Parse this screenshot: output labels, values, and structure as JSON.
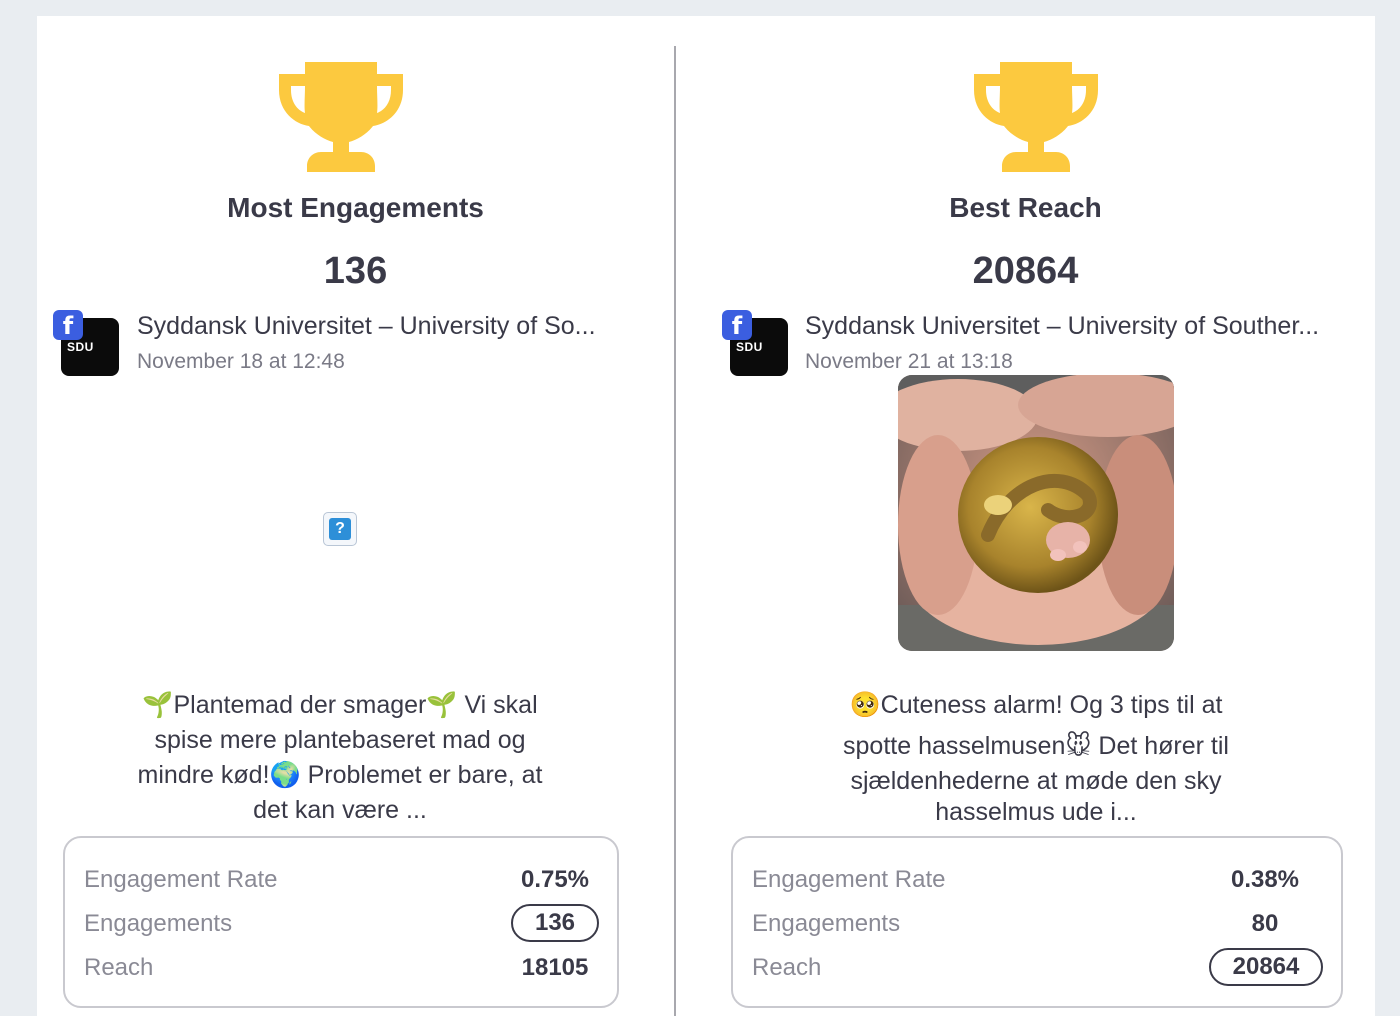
{
  "left": {
    "title": "Most Engagements",
    "value": "136",
    "page_name": "Syddansk Universitet – University of So...",
    "post_time": "November 18 at 12:48",
    "avatar_text": "SDU",
    "post_text_1": "Plantemad der smager",
    "post_text_2": " Vi skal",
    "post_text_3": "spise mere plantebaseret mad og",
    "post_text_4": "mindre kød!",
    "post_text_5": " Problemet er bare, at",
    "post_text_6": "det kan være ...",
    "stats": [
      {
        "label": "Engagement Rate",
        "value": "0.75%"
      },
      {
        "label": "Engagements",
        "value": "136"
      },
      {
        "label": "Reach",
        "value": "18105"
      }
    ]
  },
  "right": {
    "title": "Best Reach",
    "value": "20864",
    "page_name": "Syddansk Universitet – University of Souther...",
    "post_time": "November 21 at 13:18",
    "avatar_text": "SDU",
    "post_text_1": "Cuteness alarm! Og 3 tips til at",
    "post_text_2": "spotte hasselmusen",
    "post_text_3": " Det hører til",
    "post_text_4": "sjældenhederne at møde den sky",
    "post_text_5": "hasselmus ude i...",
    "stats": [
      {
        "label": "Engagement Rate",
        "value": "0.38%"
      },
      {
        "label": "Engagements",
        "value": "80"
      },
      {
        "label": "Reach",
        "value": "20864"
      }
    ]
  },
  "icons": {
    "trophy": "trophy-icon",
    "facebook": "facebook-icon",
    "missing_image": "broken-image-icon"
  },
  "colors": {
    "trophy": "#fcc93f",
    "facebook": "#3b5ee0",
    "text": "#3a3a48"
  }
}
